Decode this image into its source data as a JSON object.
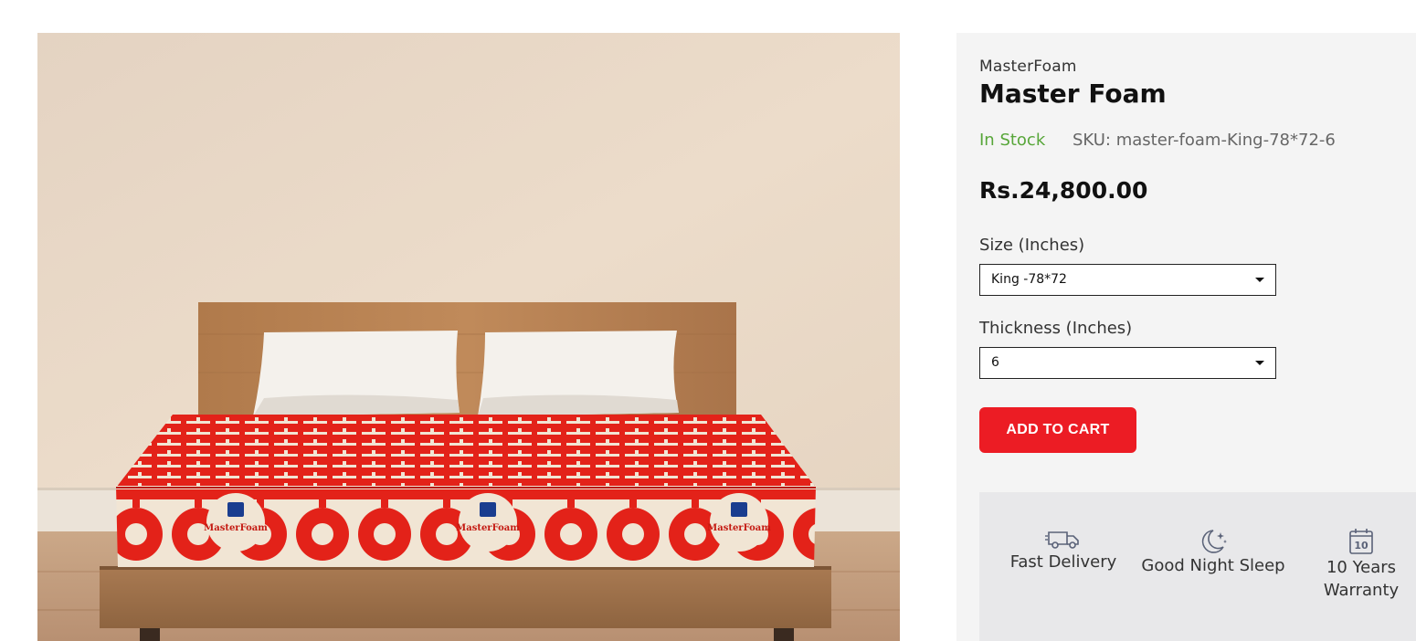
{
  "product": {
    "brand": "MasterFoam",
    "title": "Master Foam",
    "stock_status": "In Stock",
    "sku_label": "SKU:",
    "sku_value": "master-foam-King-78*72-6",
    "price": "Rs.24,800.00"
  },
  "image": {
    "mattress_brand_label": "MasterFoam"
  },
  "options": {
    "size": {
      "label": "Size (Inches)",
      "selected": "King -78*72"
    },
    "thickness": {
      "label": "Thickness (Inches)",
      "selected": "6"
    }
  },
  "cart": {
    "add_label": "ADD TO CART"
  },
  "features": [
    {
      "icon": "delivery-truck-icon",
      "line1": "Fast Delivery",
      "line2": ""
    },
    {
      "icon": "moon-stars-icon",
      "line1": "Good Night Sleep",
      "line2": ""
    },
    {
      "icon": "calendar-icon",
      "line1": "10 Years",
      "line2": "Warranty",
      "badge": "10"
    }
  ],
  "colors": {
    "accent_red": "#ec1c24",
    "in_stock_green": "#57a639",
    "panel_bg": "#f4f4f4",
    "features_bg": "#e8e8ea",
    "mattress_red": "#e32219",
    "mattress_cream": "#f1e5d4"
  }
}
